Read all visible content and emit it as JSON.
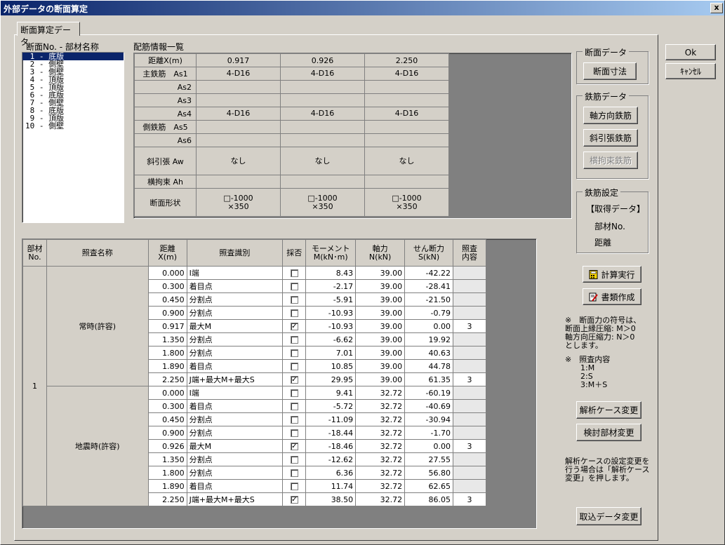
{
  "window": {
    "title": "外部データの断面算定",
    "close_label": "x"
  },
  "tab": {
    "label": "断面算定データ"
  },
  "member_list": {
    "label": "断面No. - 部材名称",
    "items": [
      " 1 - 底版",
      " 2 - 側壁",
      " 3 - 側壁",
      " 4 - 頂版",
      " 5 - 頂版",
      " 6 - 底版",
      " 7 - 側壁",
      " 8 - 底版",
      " 9 - 頂版",
      "10 - 側壁"
    ],
    "selected_index": 0
  },
  "rebar_info": {
    "label": "配筋情報一覧",
    "header": "距離X(m)",
    "columns": [
      "0.917",
      "0.926",
      "2.250"
    ],
    "rows": [
      {
        "label": "主鉄筋　As1",
        "values": [
          "4-D16",
          "4-D16",
          "4-D16"
        ]
      },
      {
        "label": "As2",
        "values": [
          "",
          "",
          ""
        ]
      },
      {
        "label": "As3",
        "values": [
          "",
          "",
          ""
        ]
      },
      {
        "label": "As4",
        "values": [
          "4-D16",
          "4-D16",
          "4-D16"
        ]
      },
      {
        "label": "側鉄筋　As5",
        "values": [
          "",
          "",
          ""
        ]
      },
      {
        "label": "As6",
        "values": [
          "",
          "",
          ""
        ]
      },
      {
        "label": "斜引張 Aw",
        "values": [
          "なし",
          "なし",
          "なし"
        ]
      },
      {
        "label": "横拘束 Ah",
        "values": [
          "",
          "",
          ""
        ]
      },
      {
        "label": "断面形状",
        "values": [
          "□-1000\n×350",
          "□-1000\n×350",
          "□-1000\n×350"
        ]
      }
    ]
  },
  "right_panel": {
    "section_data": {
      "caption": "断面データ",
      "button": "断面寸法"
    },
    "rebar_data": {
      "caption": "鉄筋データ",
      "buttons": [
        "軸方向鉄筋",
        "斜引張鉄筋",
        "横拘束鉄筋"
      ]
    },
    "rebar_setting": {
      "caption": "鉄筋設定",
      "lines": [
        "【取得データ】",
        "部材No.",
        "距離"
      ]
    },
    "calc_button": "計算実行",
    "doc_button": "書類作成",
    "note1": "※　断面力の符号は、\n断面上縁圧縮: M＞0\n軸方向圧縮力: N＞0\nとします。",
    "note2": "※　照査内容\n　　1:M\n　　2:S\n　　3:M＋S",
    "case_button": "解析ケース変更",
    "member_button": "検討部材変更",
    "note3": "解析ケースの設定変更を\n行う場合は「解析ケース\n変更」を押します。",
    "import_button": "取込データ変更"
  },
  "dialog_buttons": {
    "ok": "Ok",
    "cancel": "ｷｬﾝｾﾙ"
  },
  "check_table": {
    "headers": [
      "部材\nNo.",
      "照査名称",
      "距離\nX(m)",
      "照査識別",
      "採否",
      "モーメント\nM(kN･m)",
      "軸力\nN(kN)",
      "せん断力\nS(kN)",
      "照査\n内容"
    ],
    "member_no": "1",
    "groups": [
      {
        "name": "常時(許容)",
        "rows": [
          {
            "x": "0.000",
            "id": "I端",
            "adopt": false,
            "m": "8.43",
            "n": "39.00",
            "s": "-42.22",
            "c": ""
          },
          {
            "x": "0.300",
            "id": "着目点",
            "adopt": false,
            "m": "-2.17",
            "n": "39.00",
            "s": "-28.41",
            "c": ""
          },
          {
            "x": "0.450",
            "id": "分割点",
            "adopt": false,
            "m": "-5.91",
            "n": "39.00",
            "s": "-21.50",
            "c": ""
          },
          {
            "x": "0.900",
            "id": "分割点",
            "adopt": false,
            "m": "-10.93",
            "n": "39.00",
            "s": "-0.79",
            "c": ""
          },
          {
            "x": "0.917",
            "id": "最大M",
            "adopt": true,
            "m": "-10.93",
            "n": "39.00",
            "s": "0.00",
            "c": "3"
          },
          {
            "x": "1.350",
            "id": "分割点",
            "adopt": false,
            "m": "-6.62",
            "n": "39.00",
            "s": "19.92",
            "c": ""
          },
          {
            "x": "1.800",
            "id": "分割点",
            "adopt": false,
            "m": "7.01",
            "n": "39.00",
            "s": "40.63",
            "c": ""
          },
          {
            "x": "1.890",
            "id": "着目点",
            "adopt": false,
            "m": "10.85",
            "n": "39.00",
            "s": "44.78",
            "c": ""
          },
          {
            "x": "2.250",
            "id": "J端+最大M+最大S",
            "adopt": true,
            "m": "29.95",
            "n": "39.00",
            "s": "61.35",
            "c": "3"
          }
        ]
      },
      {
        "name": "地震時(許容)",
        "rows": [
          {
            "x": "0.000",
            "id": "I端",
            "adopt": false,
            "m": "9.41",
            "n": "32.72",
            "s": "-60.19",
            "c": ""
          },
          {
            "x": "0.300",
            "id": "着目点",
            "adopt": false,
            "m": "-5.72",
            "n": "32.72",
            "s": "-40.69",
            "c": ""
          },
          {
            "x": "0.450",
            "id": "分割点",
            "adopt": false,
            "m": "-11.09",
            "n": "32.72",
            "s": "-30.94",
            "c": ""
          },
          {
            "x": "0.900",
            "id": "分割点",
            "adopt": false,
            "m": "-18.44",
            "n": "32.72",
            "s": "-1.70",
            "c": ""
          },
          {
            "x": "0.926",
            "id": "最大M",
            "adopt": true,
            "m": "-18.46",
            "n": "32.72",
            "s": "0.00",
            "c": "3"
          },
          {
            "x": "1.350",
            "id": "分割点",
            "adopt": false,
            "m": "-12.62",
            "n": "32.72",
            "s": "27.55",
            "c": ""
          },
          {
            "x": "1.800",
            "id": "分割点",
            "adopt": false,
            "m": "6.36",
            "n": "32.72",
            "s": "56.80",
            "c": ""
          },
          {
            "x": "1.890",
            "id": "着目点",
            "adopt": false,
            "m": "11.74",
            "n": "32.72",
            "s": "62.65",
            "c": ""
          },
          {
            "x": "2.250",
            "id": "J端+最大M+最大S",
            "adopt": true,
            "m": "38.50",
            "n": "32.72",
            "s": "86.05",
            "c": "3"
          }
        ]
      }
    ]
  }
}
